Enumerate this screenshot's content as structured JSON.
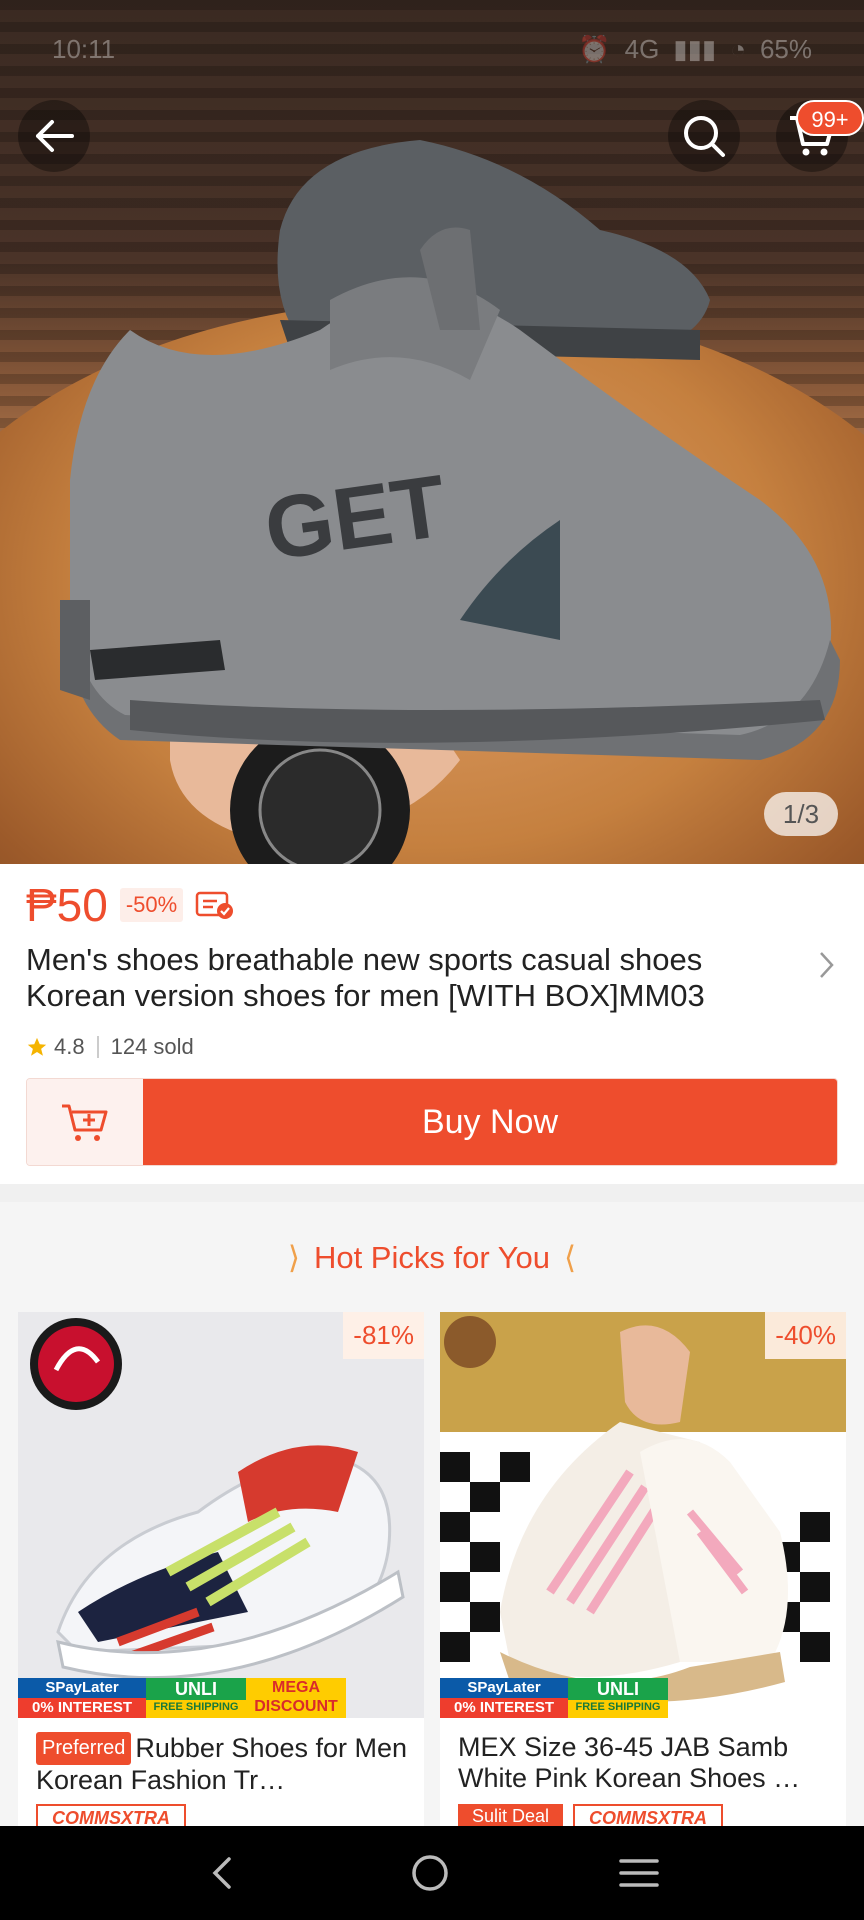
{
  "status_bar": {
    "time": "10:11",
    "network": "4G",
    "battery": "65%"
  },
  "hero": {
    "cart_badge": "99+",
    "image_counter": "1/3"
  },
  "product": {
    "price": "₱50",
    "discount": "-50%",
    "title": "Men's shoes breathable new sports casual shoes Korean version shoes for men [WITH BOX]MM03",
    "rating": "4.8",
    "sold": "124 sold",
    "buy_now_label": "Buy Now"
  },
  "hot_picks": {
    "header": "Hot Picks for You",
    "items": [
      {
        "discount": "-81%",
        "preferred_tag": "Preferred",
        "title": "Rubber Shoes for Men Korean Fashion Tr…",
        "promo_spay_top": "SPayLater",
        "promo_spay_bottom": "0% INTEREST",
        "promo_unli_top": "UNLI",
        "promo_unli_bottom": "FREE SHIPPING",
        "promo_mega_top": "MEGA",
        "promo_mega_bottom": "DISCOUNT",
        "tag": "COMMSXTRA"
      },
      {
        "discount": "-40%",
        "title": "MEX Size 36-45 JAB Samb White Pink Korean Shoes …",
        "promo_spay_top": "SPayLater",
        "promo_spay_bottom": "0% INTEREST",
        "promo_unli_top": "UNLI",
        "promo_unli_bottom": "FREE SHIPPING",
        "tag_deal": "Sulit Deal",
        "tag": "COMMSXTRA"
      }
    ]
  },
  "colors": {
    "accent": "#ee4d2d",
    "accent_light": "#fdeee9",
    "star": "#f5b400"
  }
}
